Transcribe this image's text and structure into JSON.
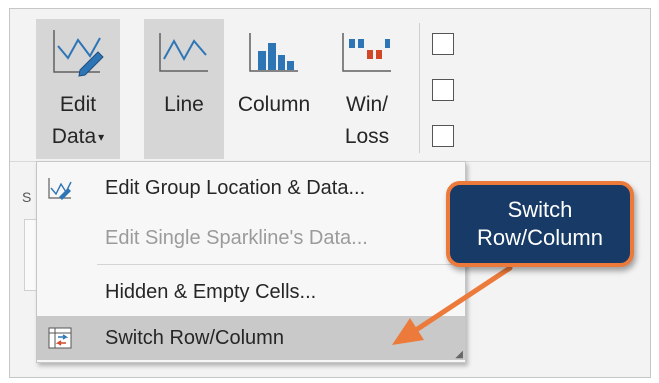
{
  "ribbon": {
    "edit_data": {
      "line1": "Edit",
      "line2": "Data",
      "caret": "▾",
      "icon": "edit-data-sparkline-icon"
    },
    "line": {
      "label": "Line",
      "icon": "line-sparkline-icon"
    },
    "column": {
      "label": "Column",
      "icon": "column-sparkline-icon"
    },
    "winloss": {
      "line1": "Win/",
      "line2": "Loss",
      "icon": "winloss-sparkline-icon"
    },
    "group_label_fragment": "S"
  },
  "menu": {
    "items": [
      {
        "label": "Edit Group Location & Data...",
        "enabled": true,
        "icon": "edit-group-data-icon"
      },
      {
        "label": "Edit Single Sparkline's Data...",
        "enabled": false
      },
      {
        "label": "Hidden & Empty Cells...",
        "enabled": true
      },
      {
        "label": "Switch Row/Column",
        "enabled": true,
        "highlighted": true,
        "icon": "switch-row-column-icon"
      }
    ]
  },
  "callout": {
    "line1": "Switch",
    "line2": "Row/Column"
  },
  "colors": {
    "callout_fill": "#173b66",
    "callout_border": "#ec7a3b",
    "arrow": "#ec7a3b",
    "sparkline_blue": "#2e75b6",
    "loss_red": "#d24726"
  }
}
